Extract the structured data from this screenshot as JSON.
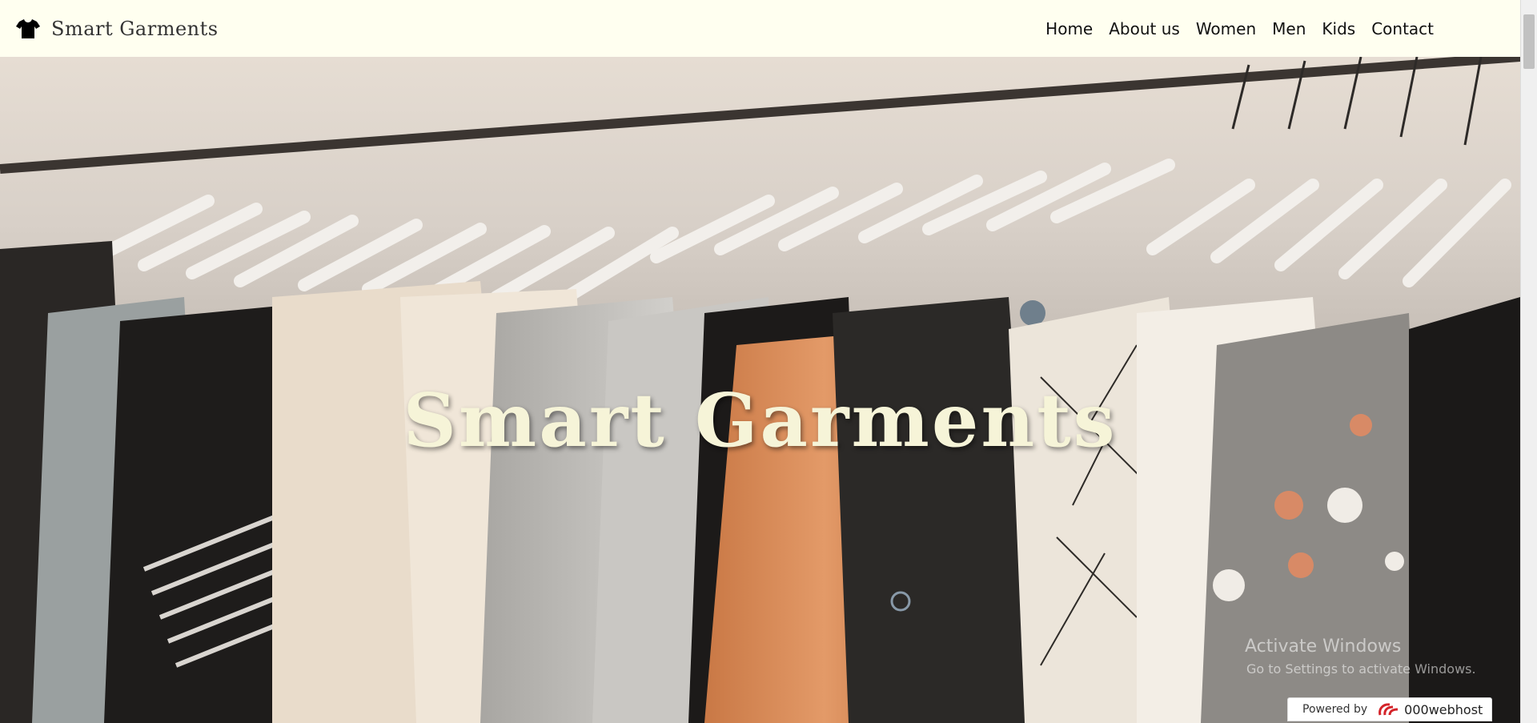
{
  "header": {
    "brand_name": "Smart Garments",
    "brand_icon": "tshirt-icon"
  },
  "nav": {
    "items": [
      {
        "label": "Home"
      },
      {
        "label": "About us"
      },
      {
        "label": "Women"
      },
      {
        "label": "Men"
      },
      {
        "label": "Kids"
      },
      {
        "label": "Contact"
      }
    ]
  },
  "hero": {
    "title": "Smart Garments"
  },
  "watermark": {
    "title": "Activate Windows",
    "subtitle": "Go to Settings to activate Windows."
  },
  "footer_badge": {
    "label": "Powered by",
    "brand": "000webhost",
    "icon": "000webhost-logo-icon"
  },
  "colors": {
    "navbar_bg": "#fffff0",
    "hero_title": "#f6f4d8"
  }
}
